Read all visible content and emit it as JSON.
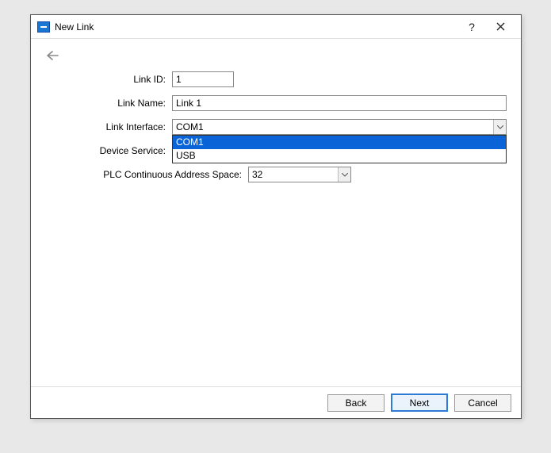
{
  "title": "New Link",
  "labels": {
    "link_id": "Link ID:",
    "link_name": "Link Name:",
    "link_interface": "Link Interface:",
    "device_service": "Device Service:",
    "plc_space": "PLC Continuous Address Space:"
  },
  "values": {
    "link_id": "1",
    "link_name": "Link 1",
    "link_interface": "COM1",
    "plc_space": "32"
  },
  "interface_options": {
    "o0": "COM1",
    "o1": "USB"
  },
  "buttons": {
    "back": "Back",
    "next": "Next",
    "cancel": "Cancel"
  },
  "title_help": "?"
}
